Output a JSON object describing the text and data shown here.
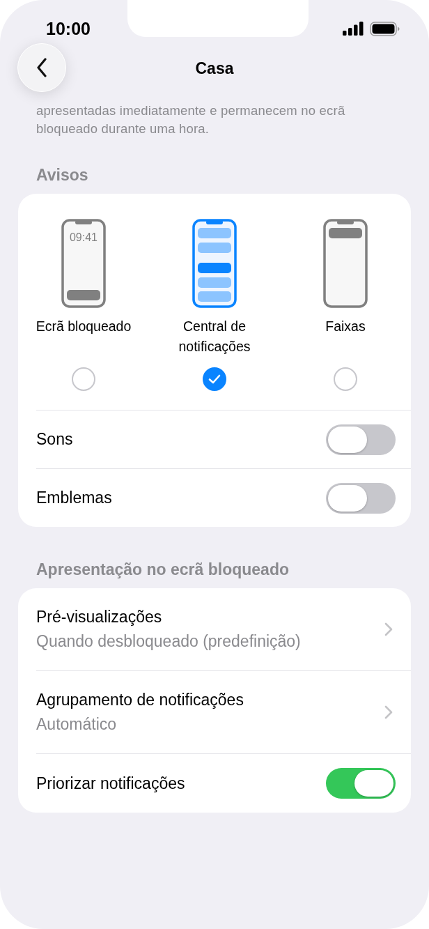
{
  "status_bar": {
    "time": "10:00"
  },
  "nav": {
    "title": "Casa"
  },
  "description": [
    "apresentadas imediatamente e permanecem no ecrã",
    "bloqueado durante uma hora."
  ],
  "alerts": {
    "header": "Avisos",
    "options": [
      {
        "kind": "lockscreen",
        "label": "Ecrã bloqueado",
        "screen_time": "09:41",
        "selected": false
      },
      {
        "kind": "center",
        "label": "Central de notificações",
        "selected": true
      },
      {
        "kind": "banner",
        "label": "Faixas",
        "selected": false
      }
    ],
    "toggles": [
      {
        "label": "Sons",
        "on": false
      },
      {
        "label": "Emblemas",
        "on": false
      }
    ]
  },
  "lock_screen": {
    "header": "Apresentação no ecrã bloqueado",
    "rows": [
      {
        "kind": "link",
        "title": "Pré-visualizações",
        "value": "Quando desbloqueado (predefinição)"
      },
      {
        "kind": "link",
        "title": "Agrupamento de notificações",
        "value": "Automático"
      },
      {
        "kind": "toggle",
        "title": "Priorizar notificações",
        "on": true
      }
    ]
  }
}
